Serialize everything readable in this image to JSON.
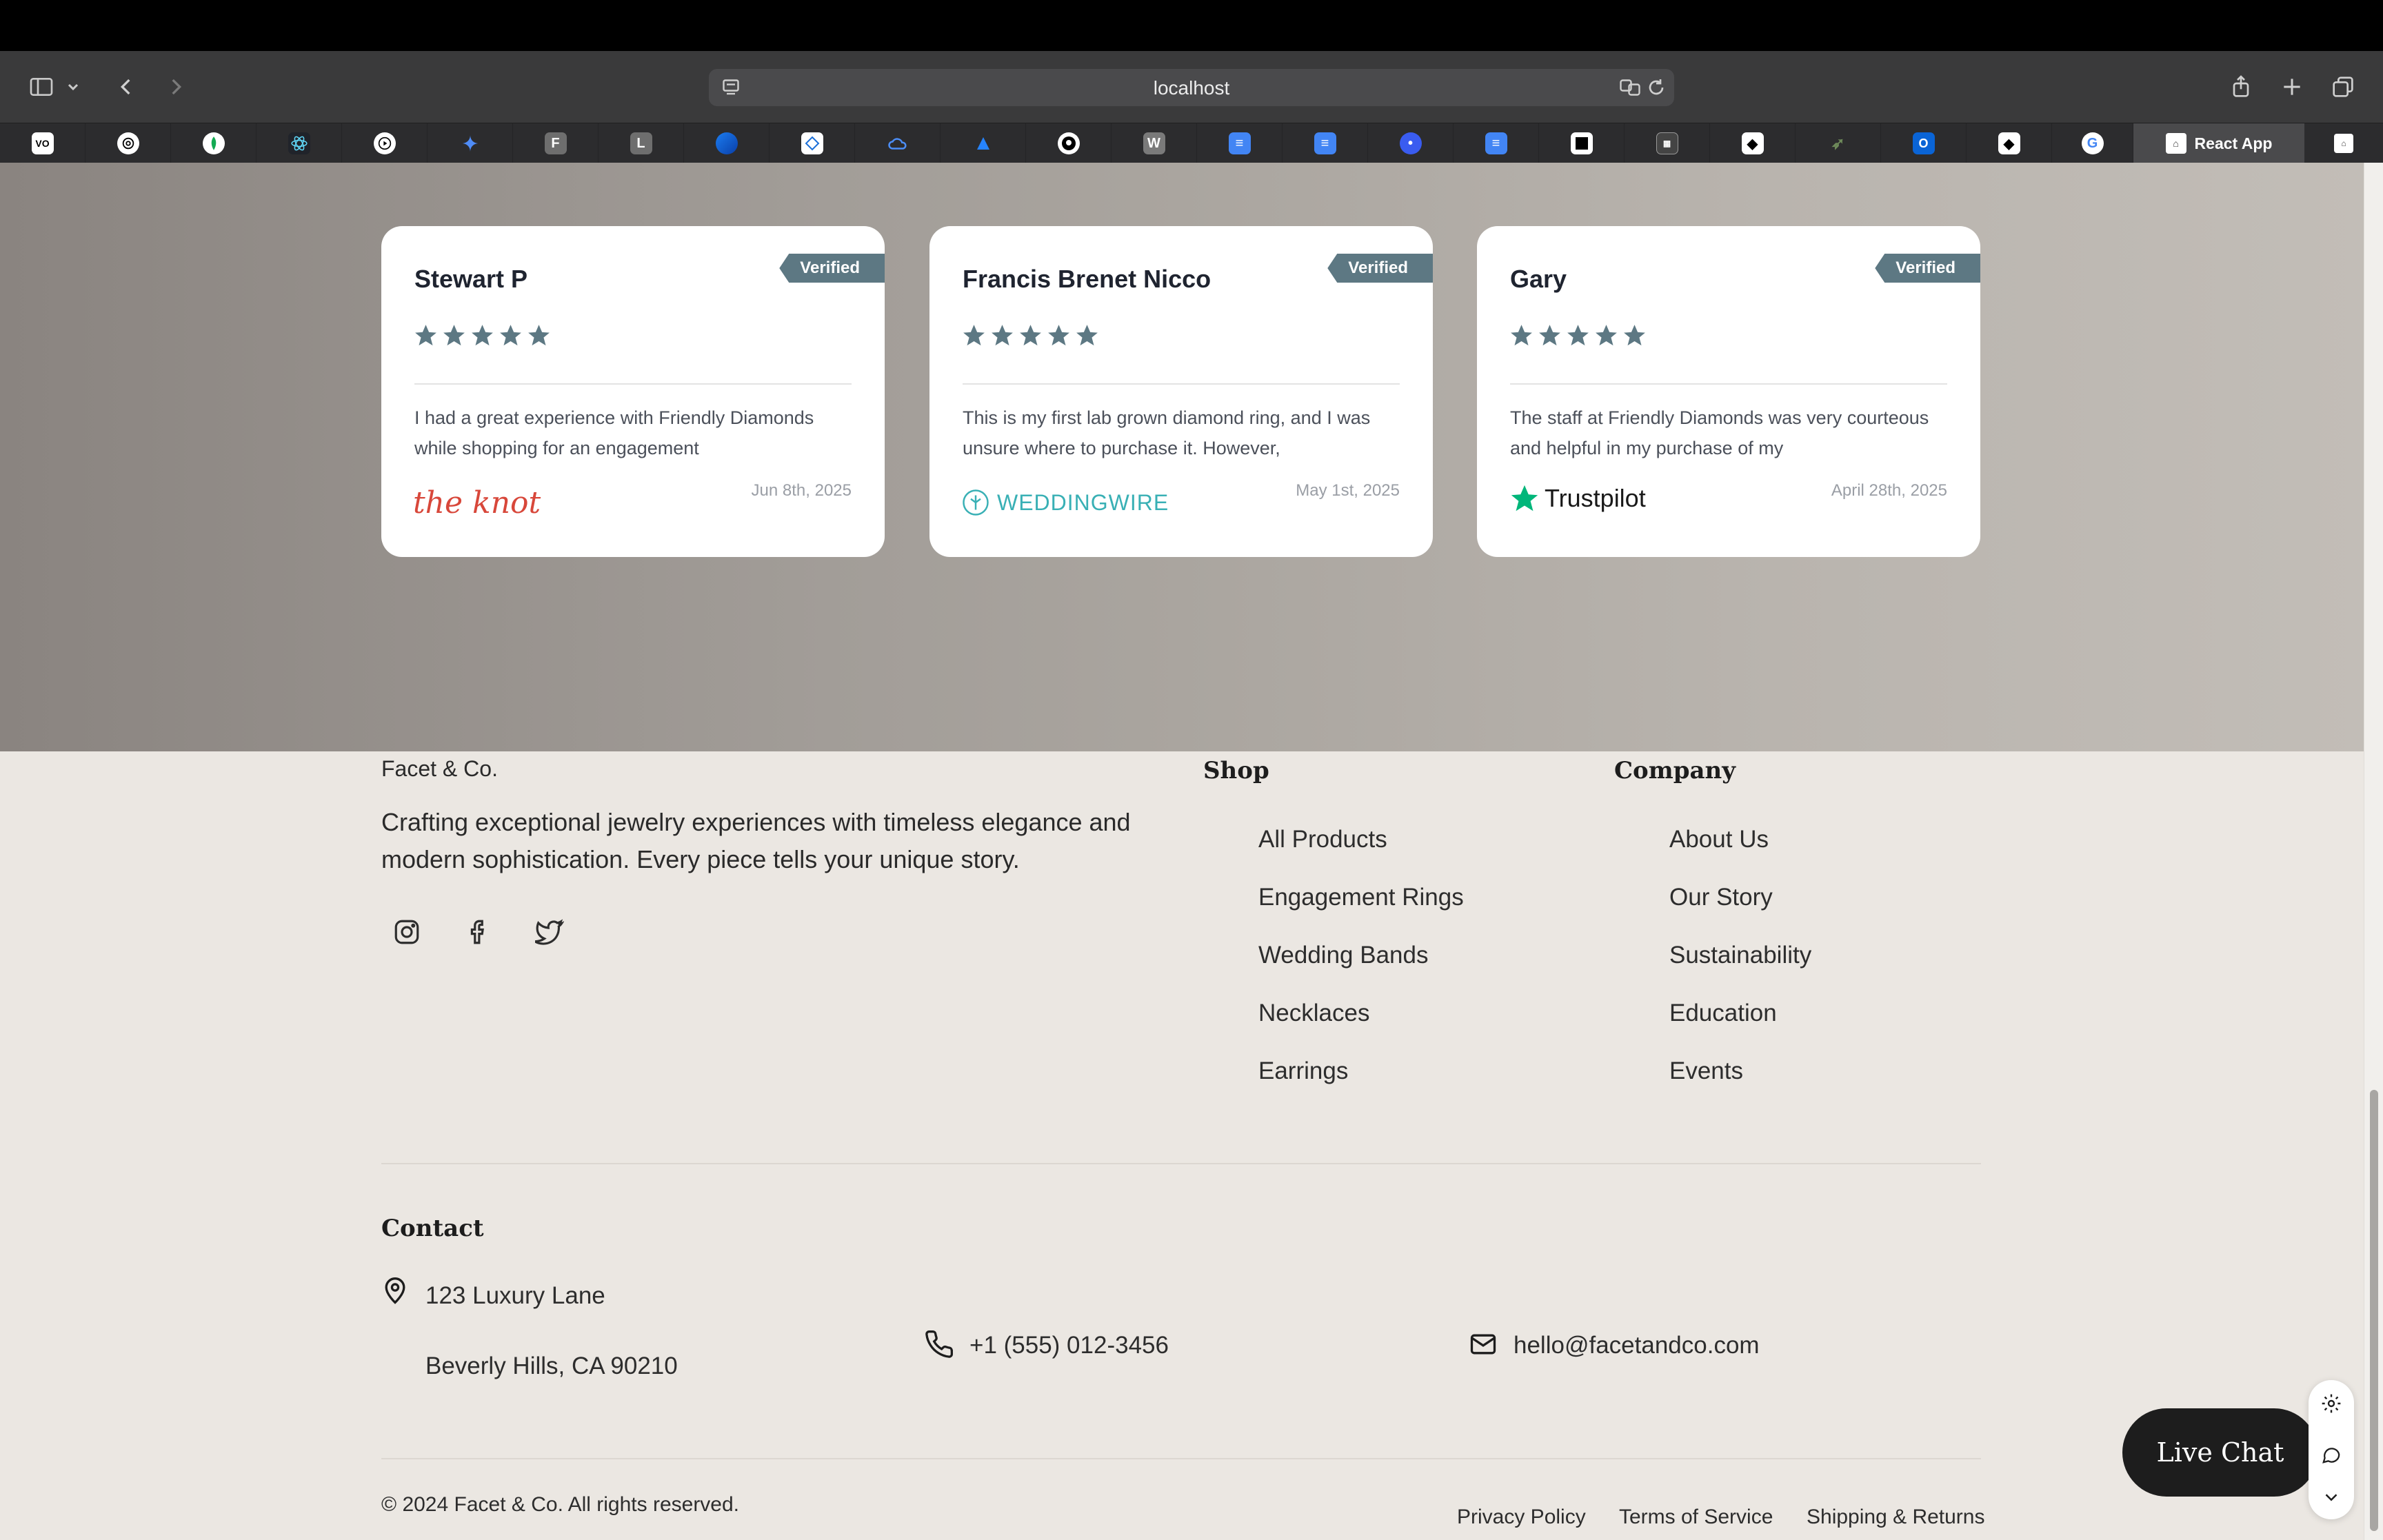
{
  "browser": {
    "url": "localhost",
    "active_tab_title": "React App"
  },
  "reviews": [
    {
      "name": "Stewart P",
      "badge": "Verified",
      "rating": 5,
      "text": "I had a great experience with Friendly Diamonds while shopping for an engagement",
      "date": "Jun 8th, 2025",
      "source": "the knot"
    },
    {
      "name": "Francis Brenet Nicco",
      "badge": "Verified",
      "rating": 5,
      "text": "This is my first lab grown diamond ring, and I was unsure where to purchase it. However,",
      "date": "May 1st, 2025",
      "source": "WEDDINGWIRE"
    },
    {
      "name": "Gary",
      "badge": "Verified",
      "rating": 5,
      "text": "The staff at Friendly Diamonds was very courteous and helpful in my purchase of my",
      "date": "April 28th, 2025",
      "source": "Trustpilot"
    }
  ],
  "footer": {
    "brand": "Facet & Co.",
    "tagline": "Crafting exceptional jewelry experiences with timeless elegance and modern sophistication. Every piece tells your unique story.",
    "shop": {
      "title": "Shop",
      "links": [
        "All Products",
        "Engagement Rings",
        "Wedding Bands",
        "Necklaces",
        "Earrings"
      ]
    },
    "company": {
      "title": "Company",
      "links": [
        "About Us",
        "Our Story",
        "Sustainability",
        "Education",
        "Events"
      ]
    },
    "contact": {
      "title": "Contact",
      "address_line1": "123 Luxury Lane",
      "address_line2": "Beverly Hills, CA 90210",
      "phone": "+1 (555) 012-3456",
      "email": "hello@facetandco.com"
    },
    "copyright": "© 2024 Facet & Co. All rights reserved.",
    "legal": [
      "Privacy Policy",
      "Terms of Service",
      "Shipping & Returns"
    ]
  },
  "live_chat": "Live Chat",
  "colors": {
    "accent": "#5d7883",
    "footer_bg": "#ebe7e2",
    "chat_bg": "#1d1d1d"
  }
}
